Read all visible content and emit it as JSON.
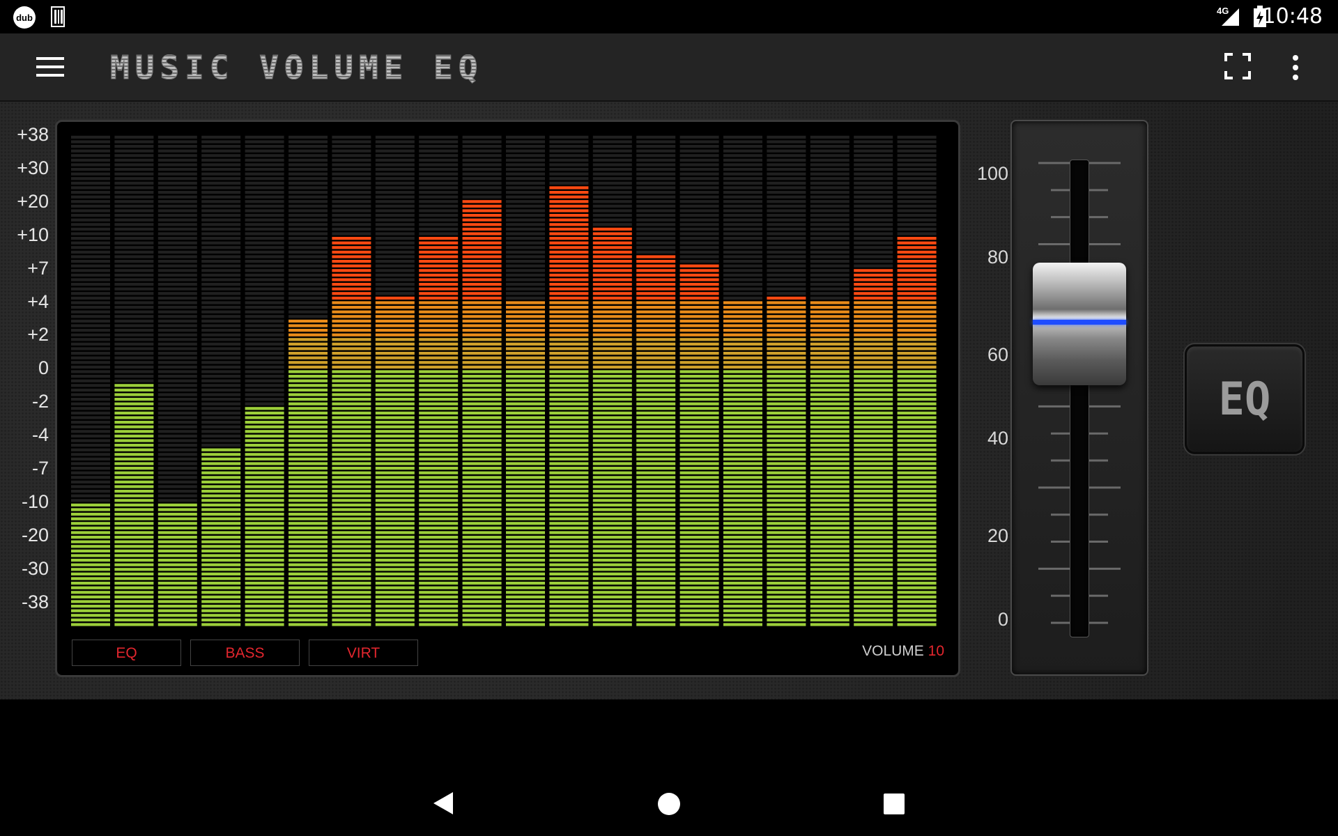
{
  "status_bar": {
    "time": "10:48",
    "left_icons": [
      "dub-icon",
      "barcode-icon"
    ],
    "right_icons": [
      "signal-4g-icon",
      "battery-icon"
    ],
    "network_label": "4G"
  },
  "app_bar": {
    "title": "MUSIC VOLUME EQ",
    "icons": [
      "menu-icon",
      "fullscreen-icon",
      "overflow-menu-icon"
    ]
  },
  "equalizer": {
    "db_scale": [
      "+38",
      "+30",
      "+20",
      "+10",
      "+7",
      "+4",
      "+2",
      "0",
      "-2",
      "-4",
      "-7",
      "-10",
      "-20",
      "-30",
      "-38"
    ],
    "band_count": 20,
    "band_levels_db": [
      -10.6,
      -1.1,
      -11.7,
      -5.3,
      -2.4,
      3.0,
      10.0,
      4.4,
      10.0,
      20.0,
      4.1,
      24.0,
      12.5,
      8.1,
      7.3,
      4.1,
      4.4,
      4.1,
      6.7,
      10.0
    ],
    "colors": {
      "low_segment": "#9ccf3a",
      "mid_segment": "#e98b1a",
      "high_segment": "#ff4a12",
      "empty_segment": "#202020"
    },
    "preset_buttons": [
      "EQ",
      "BASS",
      "VIRT"
    ],
    "volume_label": "VOLUME",
    "volume_value": "10"
  },
  "volume_slider": {
    "scale": [
      "100",
      "80",
      "60",
      "40",
      "20",
      "0"
    ],
    "value_percent": 62,
    "accent_color": "#1e4cff"
  },
  "eq_toggle": {
    "label": "EQ"
  },
  "nav_bar": {
    "icons": [
      "back-icon",
      "home-icon",
      "recents-icon"
    ]
  }
}
